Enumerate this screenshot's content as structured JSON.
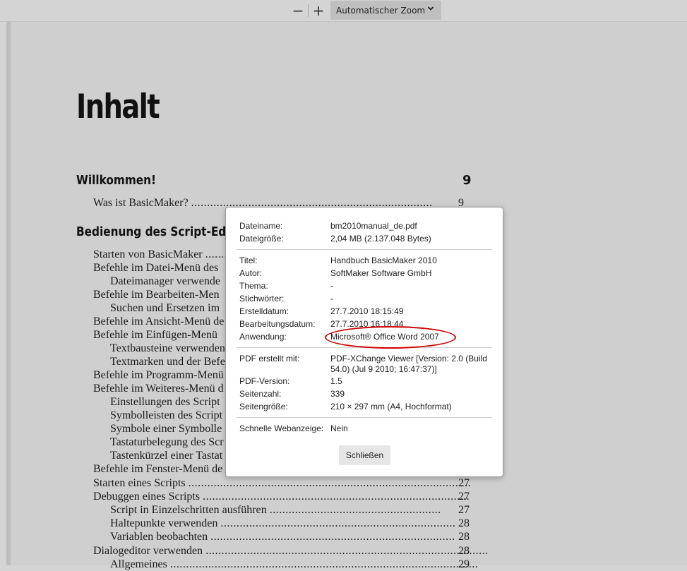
{
  "toolbar": {
    "zoom_out_icon": "minus-icon",
    "zoom_in_icon": "plus-icon",
    "zoom_value": "Automatischer Zoom",
    "zoom_out_glyph": "−",
    "zoom_in_glyph": "+",
    "chevron_glyph": "⌄"
  },
  "page": {
    "heading": "Inhalt",
    "sections": [
      {
        "title": "Willkommen!",
        "page": "9"
      },
      {
        "title": "Bedienung des Script-Editors",
        "page": ""
      }
    ],
    "entries": [
      {
        "text": "Was ist BasicMaker? ",
        "dots": "............................................................................",
        "page": "9"
      },
      {
        "text": "Starten von BasicMaker ",
        "dots": "..................................",
        "page": ""
      },
      {
        "text": "Befehle im Datei-Menü des ",
        "dots": "",
        "page": ""
      },
      {
        "text": "Dateimanager verwende",
        "dots": "",
        "page": ""
      },
      {
        "text": "Befehle im Bearbeiten-Men",
        "dots": "",
        "page": ""
      },
      {
        "text": "Suchen und Ersetzen im",
        "dots": "",
        "page": ""
      },
      {
        "text": "Befehle im Ansicht-Menü de",
        "dots": "",
        "page": ""
      },
      {
        "text": "Befehle im Einfügen-Menü ",
        "dots": "",
        "page": ""
      },
      {
        "text": "Textbausteine verwenden",
        "dots": "",
        "page": ""
      },
      {
        "text": "Textmarken und der Befe",
        "dots": "",
        "page": ""
      },
      {
        "text": "Befehle im Programm-Menü",
        "dots": "",
        "page": ""
      },
      {
        "text": "Befehle im Weiteres-Menü d",
        "dots": "",
        "page": ""
      },
      {
        "text": "Einstellungen des Script",
        "dots": "",
        "page": ""
      },
      {
        "text": "Symbolleisten des Script",
        "dots": "",
        "page": ""
      },
      {
        "text": "Symbole einer Symbolle",
        "dots": "",
        "page": ""
      },
      {
        "text": "Tastaturbelegung des Scr",
        "dots": "",
        "page": ""
      },
      {
        "text": "Tastenkürzel einer Tastat",
        "dots": "",
        "page": ""
      },
      {
        "text": "Befehle im Fenster-Menü de",
        "dots": "",
        "page": ""
      },
      {
        "text": "Starten eines Scripts ",
        "dots": ".........................................................................................",
        "page": "27"
      },
      {
        "text": "Debuggen eines Scripts ",
        "dots": "....................................................................................",
        "page": "27"
      },
      {
        "text": "Script in Einzelschritten ausführen ",
        "dots": "......................................................",
        "page": "27"
      },
      {
        "text": "Haltepunkte verwenden ",
        "dots": "..........................................................................",
        "page": "28"
      },
      {
        "text": "Variablen beobachten ",
        "dots": ".............................................................................",
        "page": "28"
      },
      {
        "text": "Dialogeditor verwenden ",
        "dots": ".........................................................................................",
        "page": "28"
      },
      {
        "text": "Allgemeines ",
        "dots": ".................................................................................................",
        "page": "29"
      }
    ]
  },
  "dialog": {
    "file_group": [
      {
        "label": "Dateiname:",
        "value": "bm2010manual_de.pdf"
      },
      {
        "label": "Dateigröße:",
        "value": "2,04 MB (2.137.048 Bytes)"
      }
    ],
    "meta_group": [
      {
        "label": "Titel:",
        "value": "Handbuch BasicMaker 2010"
      },
      {
        "label": "Autor:",
        "value": "SoftMaker Software GmbH"
      },
      {
        "label": "Thema:",
        "value": "-"
      },
      {
        "label": "Stichwörter:",
        "value": "-"
      },
      {
        "label": "Erstelldatum:",
        "value": "27.7.2010 18:15:49"
      },
      {
        "label": "Bearbeitungsdatum:",
        "value": "27.7.2010 16:18:44"
      },
      {
        "label": "Anwendung:",
        "value": "Microsoft® Office Word 2007"
      }
    ],
    "pdf_group": [
      {
        "label": "PDF erstellt mit:",
        "value": "PDF-XChange Viewer [Version: 2.0 (Build 54.0) (Jul 9 2010; 16:47:37)]"
      },
      {
        "label": "PDF-Version:",
        "value": "1.5"
      },
      {
        "label": "Seitenzahl:",
        "value": "339"
      },
      {
        "label": "Seitengröße:",
        "value": "210 × 297 mm (A4, Hochformat)"
      }
    ],
    "web_group": [
      {
        "label": "Schnelle Webanzeige:",
        "value": "Nein"
      }
    ],
    "close_label": "Schließen",
    "highlight_color": "#d10000"
  }
}
